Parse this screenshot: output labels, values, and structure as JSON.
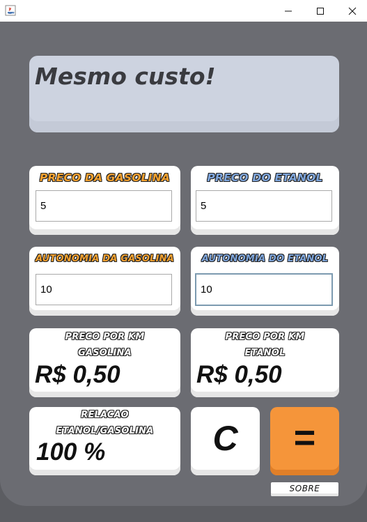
{
  "window": {
    "minimize_icon": "minimize-icon",
    "maximize_icon": "maximize-icon",
    "close_icon": "close-icon",
    "app_icon": "java-icon"
  },
  "display": {
    "text": "Mesmo custo!"
  },
  "gasolina_price": {
    "label": "PRECO DA GASOLINA",
    "value": "5"
  },
  "etanol_price": {
    "label": "PRECO DO ETANOL",
    "value": "5"
  },
  "gasolina_autonomy": {
    "label": "AUTONOMIA DA GASOLINA",
    "value": "10"
  },
  "etanol_autonomy": {
    "label": "AUTONOMIA DO ETANOL",
    "value": "10"
  },
  "gasolina_km": {
    "label_line1": "PRECO POR KM",
    "label_line2": "GASOLINA",
    "value": "R$ 0,50"
  },
  "etanol_km": {
    "label_line1": "PRECO POR KM",
    "label_line2": "ETANOL",
    "value": "R$ 0,50"
  },
  "relacao": {
    "label_line1": "RELACAO",
    "label_line2": "ETANOL/GASOLINA",
    "value": "100 %"
  },
  "buttons": {
    "clear": "C",
    "equals": "=",
    "about": "SOBRE"
  },
  "colors": {
    "orange": "#f5953a",
    "blue_label": "#7fa6dc",
    "display_bg": "#cdd3e0",
    "panel": "#6b6c72"
  }
}
